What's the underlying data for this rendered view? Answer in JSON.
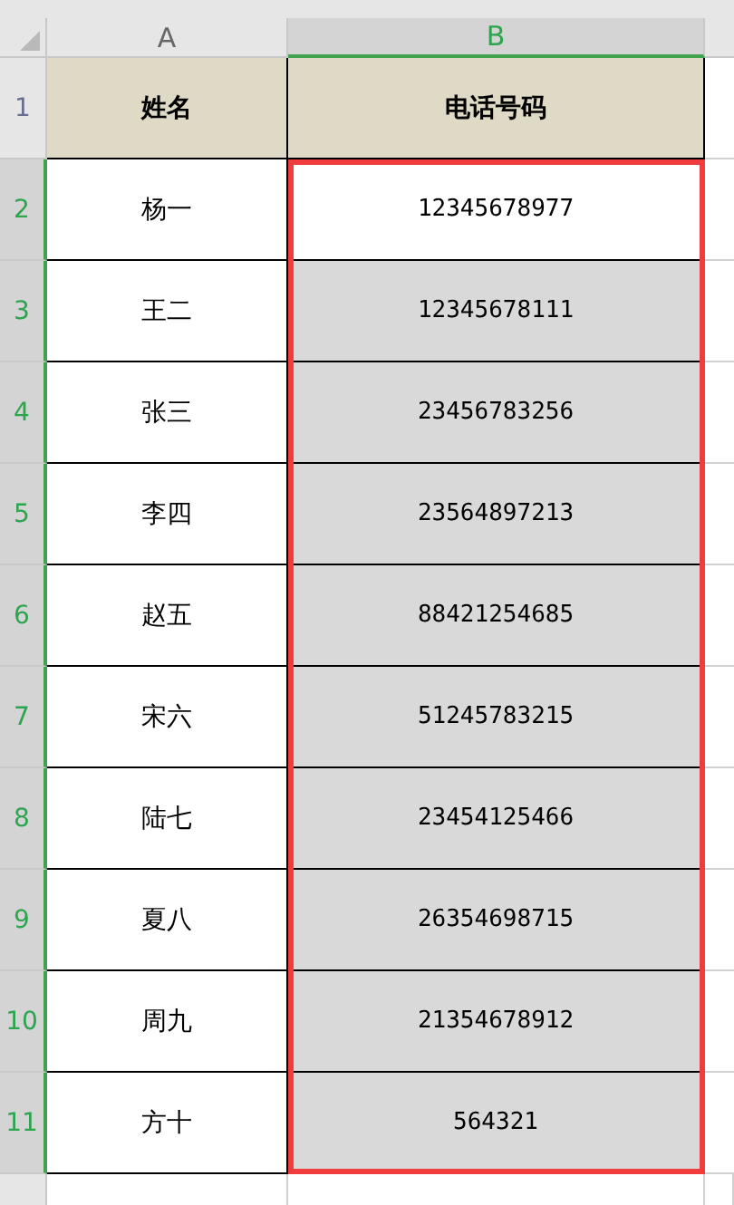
{
  "columns": [
    {
      "label": "A",
      "selected": false
    },
    {
      "label": "B",
      "selected": true
    }
  ],
  "rows": [
    {
      "number": "1",
      "selected": false,
      "cells": [
        {
          "text": "姓名",
          "kind": "header",
          "selected": false
        },
        {
          "text": "电话号码",
          "kind": "header",
          "selected": false
        }
      ]
    },
    {
      "number": "2",
      "selected": true,
      "cells": [
        {
          "text": "杨一",
          "kind": "data",
          "selected": false
        },
        {
          "text": "12345678977",
          "kind": "data",
          "selected": true,
          "active": true
        }
      ]
    },
    {
      "number": "3",
      "selected": true,
      "cells": [
        {
          "text": "王二",
          "kind": "data",
          "selected": false
        },
        {
          "text": "12345678111",
          "kind": "data",
          "selected": true,
          "active": false
        }
      ]
    },
    {
      "number": "4",
      "selected": true,
      "cells": [
        {
          "text": "张三",
          "kind": "data",
          "selected": false
        },
        {
          "text": "23456783256",
          "kind": "data",
          "selected": true,
          "active": false
        }
      ]
    },
    {
      "number": "5",
      "selected": true,
      "cells": [
        {
          "text": "李四",
          "kind": "data",
          "selected": false
        },
        {
          "text": "23564897213",
          "kind": "data",
          "selected": true,
          "active": false
        }
      ]
    },
    {
      "number": "6",
      "selected": true,
      "cells": [
        {
          "text": "赵五",
          "kind": "data",
          "selected": false
        },
        {
          "text": "88421254685",
          "kind": "data",
          "selected": true,
          "active": false
        }
      ]
    },
    {
      "number": "7",
      "selected": true,
      "cells": [
        {
          "text": "宋六",
          "kind": "data",
          "selected": false
        },
        {
          "text": "51245783215",
          "kind": "data",
          "selected": true,
          "active": false
        }
      ]
    },
    {
      "number": "8",
      "selected": true,
      "cells": [
        {
          "text": "陆七",
          "kind": "data",
          "selected": false
        },
        {
          "text": "23454125466",
          "kind": "data",
          "selected": true,
          "active": false
        }
      ]
    },
    {
      "number": "9",
      "selected": true,
      "cells": [
        {
          "text": "夏八",
          "kind": "data",
          "selected": false
        },
        {
          "text": "26354698715",
          "kind": "data",
          "selected": true,
          "active": false
        }
      ]
    },
    {
      "number": "10",
      "selected": true,
      "cells": [
        {
          "text": "周九",
          "kind": "data",
          "selected": false
        },
        {
          "text": "21354678912",
          "kind": "data",
          "selected": true,
          "active": false
        }
      ]
    },
    {
      "number": "11",
      "selected": true,
      "cells": [
        {
          "text": "方十",
          "kind": "data",
          "selected": false
        },
        {
          "text": "564321",
          "kind": "data",
          "selected": true,
          "active": false
        }
      ]
    }
  ]
}
